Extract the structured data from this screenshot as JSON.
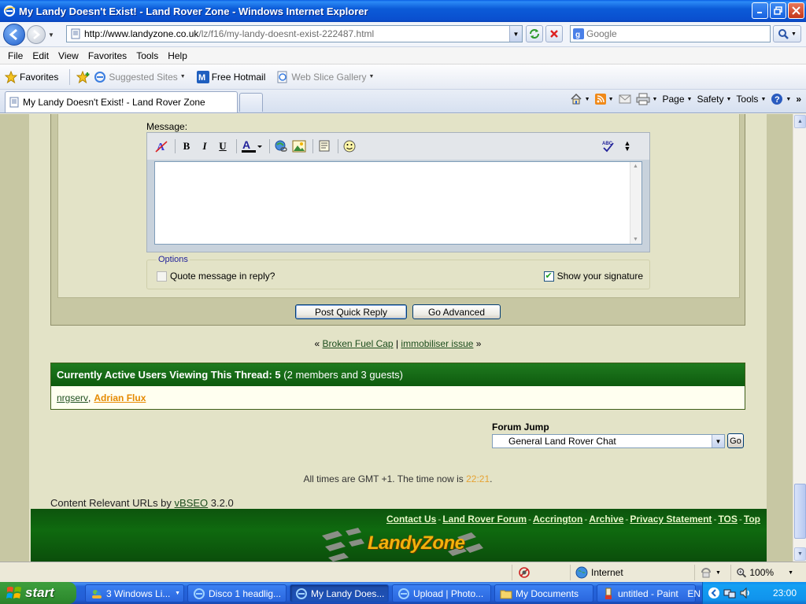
{
  "window": {
    "title": "My Landy Doesn't Exist! - Land Rover Zone - Windows Internet Explorer"
  },
  "address_bar": {
    "url_prefix": "http://www.landyzone.co.uk",
    "url_rest": "/lz/f16/my-landy-doesnt-exist-222487.html"
  },
  "search_box": {
    "placeholder": "Google"
  },
  "menu": [
    "File",
    "Edit",
    "View",
    "Favorites",
    "Tools",
    "Help"
  ],
  "favorites_bar": {
    "favorites_label": "Favorites",
    "items": [
      {
        "label": "Suggested Sites"
      },
      {
        "label": "Free Hotmail"
      },
      {
        "label": "Web Slice Gallery"
      }
    ]
  },
  "tab": {
    "title": "My Landy Doesn't Exist! - Land Rover Zone"
  },
  "command_bar": {
    "page": "Page",
    "safety": "Safety",
    "tools": "Tools"
  },
  "quick_reply": {
    "message_label": "Message:",
    "options_legend": "Options",
    "quote_label": "Quote message in reply?",
    "signature_label": "Show your signature",
    "post_button": "Post Quick Reply",
    "advanced_button": "Go Advanced"
  },
  "thread_nav": {
    "left_quote": "«",
    "prev": "Broken Fuel Cap",
    "divider": "|",
    "next": "immobiliser issue",
    "right_quote": "»"
  },
  "active_users": {
    "heading": "Currently Active Users Viewing This Thread: 5",
    "heading_detail": "(2 members and 3 guests)",
    "member1": "nrgserv",
    "comma": ",",
    "member2": "Adrian Flux"
  },
  "forum_jump": {
    "label": "Forum Jump",
    "selected": "General Land Rover Chat",
    "go": "Go"
  },
  "times": {
    "text": "All times are GMT +1. The time now is",
    "now": "22:21",
    "period": "."
  },
  "vbseo": {
    "prefix": "Content Relevant URLs by",
    "link": "vBSEO",
    "version": "3.2.0"
  },
  "footer_links": [
    "Contact Us",
    "Land Rover Forum",
    "Accrington",
    "Archive",
    "Privacy Statement",
    "TOS",
    "Top"
  ],
  "footer_sep": "-",
  "logo_text": "LandyZone",
  "status_bar": {
    "zone": "Internet",
    "zoom": "100%"
  },
  "taskbar": {
    "start": "start",
    "tasks": [
      {
        "label": "3 Windows Li..."
      },
      {
        "label": "Disco 1 headlig..."
      },
      {
        "label": "My Landy Does..."
      },
      {
        "label": "Upload | Photo..."
      },
      {
        "label": "My Documents"
      },
      {
        "label": "untitled - Paint"
      }
    ],
    "language": "EN",
    "clock": "23:00"
  },
  "colors": {
    "page_bg": "#e3e3c7",
    "forum_green": "#0e5a0e",
    "link_green": "#1e4e1e",
    "highlight_orange": "#e68a00"
  }
}
